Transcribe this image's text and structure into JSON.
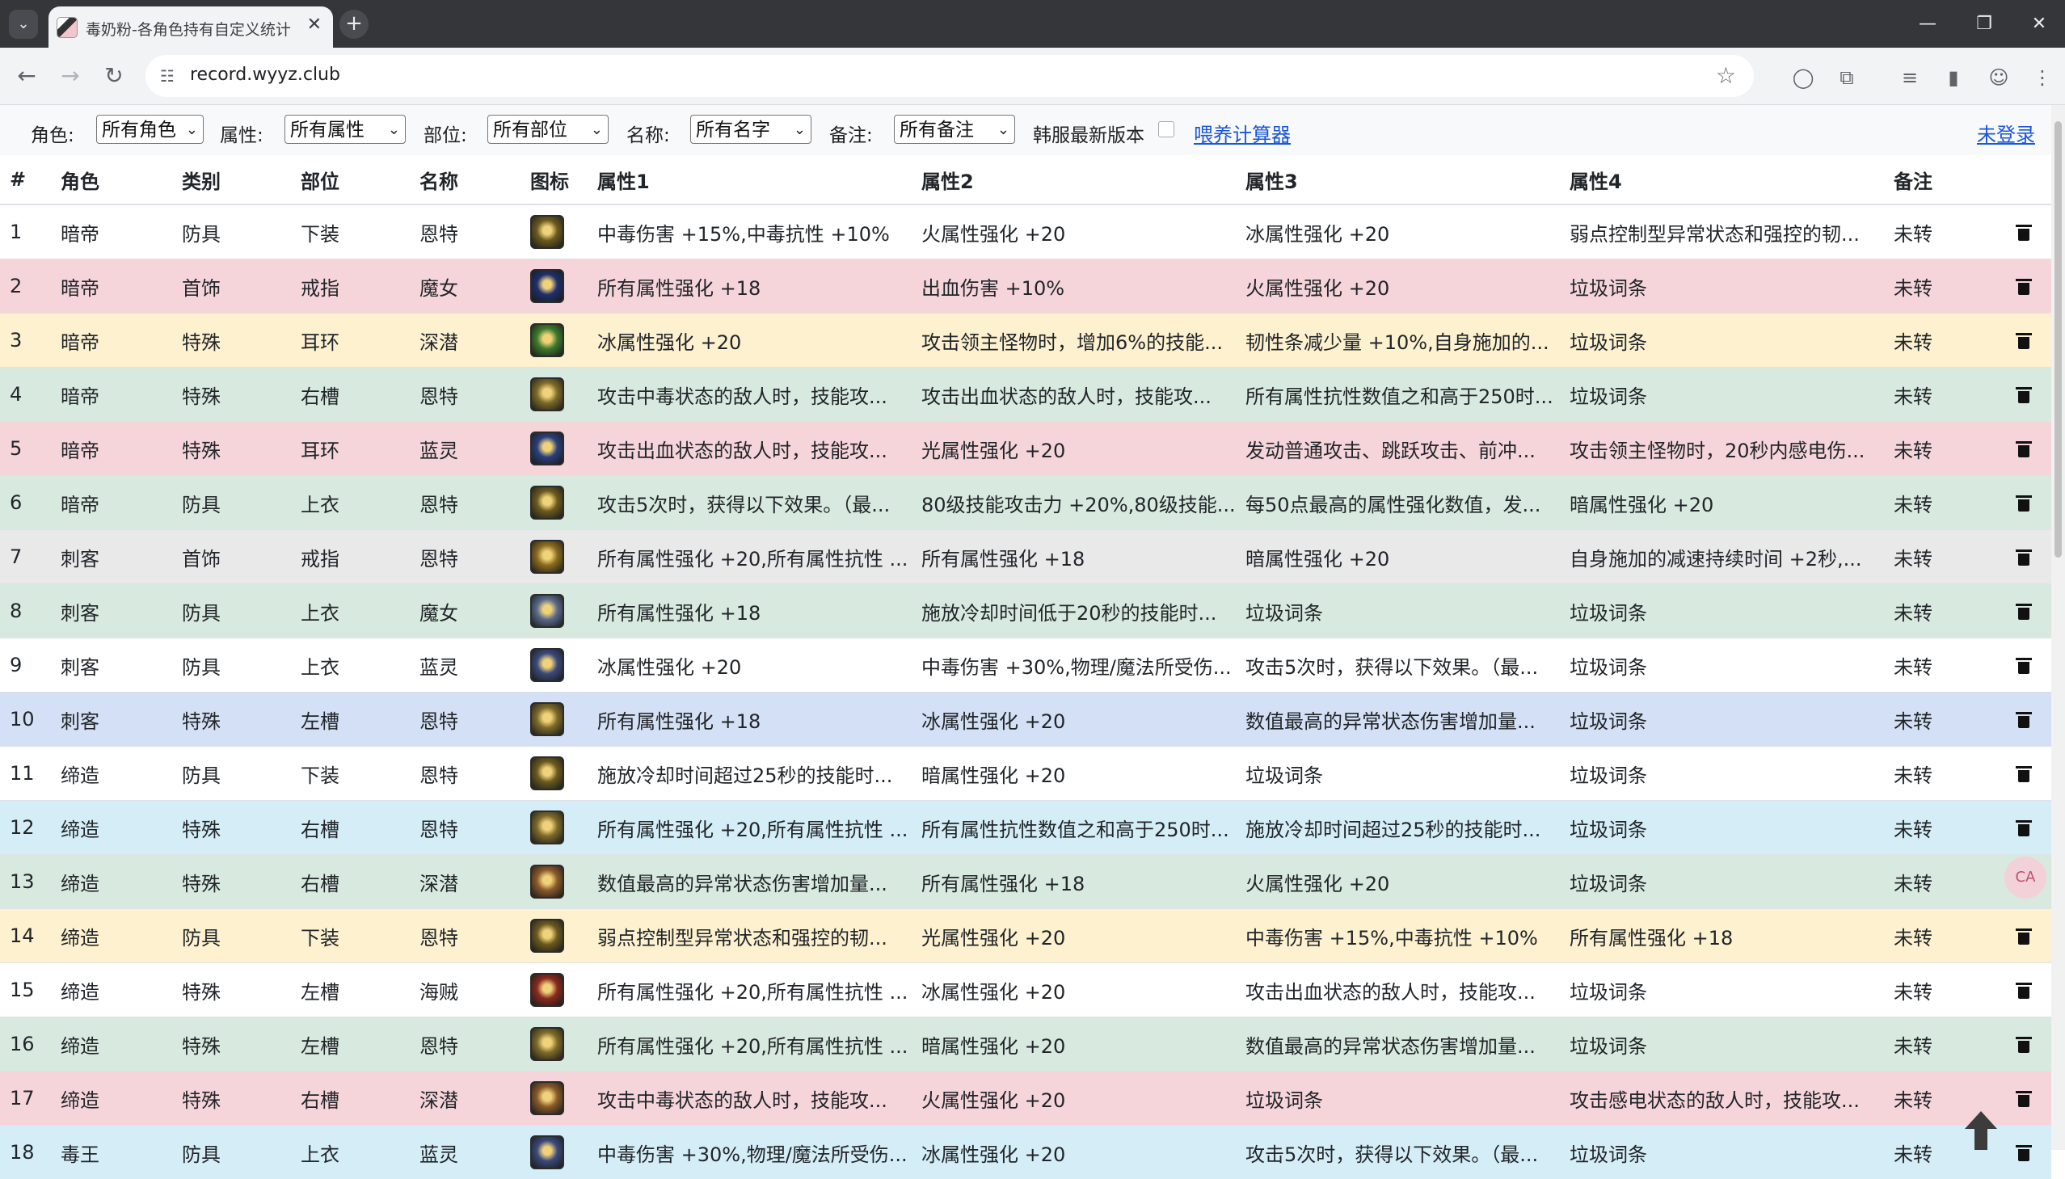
{
  "browser": {
    "tab_title": "毒奶粉-各角色持有自定义统计",
    "url": "record.wyyz.club"
  },
  "filters": {
    "role_label": "角色:",
    "role_value": "所有角色",
    "attr_label": "属性:",
    "attr_value": "所有属性",
    "part_label": "部位:",
    "part_value": "所有部位",
    "name_label": "名称:",
    "name_value": "所有名字",
    "note_label": "备注:",
    "note_value": "所有备注",
    "kr_label": "韩服最新版本",
    "calc_link": "喂养计算器",
    "login_link": "未登录"
  },
  "table": {
    "headers": [
      "#",
      "角色",
      "类别",
      "部位",
      "名称",
      "图标",
      "属性1",
      "属性2",
      "属性3",
      "属性4",
      "备注"
    ],
    "rows": [
      {
        "no": "1",
        "role": "暗帝",
        "cat": "防具",
        "part": "下装",
        "name": "恩特",
        "a1": "中毒伤害 +15%,中毒抗性 +10%",
        "a2": "火属性强化 +20",
        "a3": "冰属性强化 +20",
        "a4": "弱点控制型异常状态和强控的韧...",
        "note": "未转",
        "bg": "#ffffff",
        "icon": "#6b5a1f"
      },
      {
        "no": "2",
        "role": "暗帝",
        "cat": "首饰",
        "part": "戒指",
        "name": "魔女",
        "a1": "所有属性强化 +18",
        "a2": "出血伤害 +10%",
        "a3": "火属性强化 +20",
        "a4": "垃圾词条",
        "note": "未转",
        "bg": "#f5d5da",
        "icon": "#1e2f6b"
      },
      {
        "no": "3",
        "role": "暗帝",
        "cat": "特殊",
        "part": "耳环",
        "name": "深潜",
        "a1": "冰属性强化 +20",
        "a2": "攻击领主怪物时，增加6%的技能...",
        "a3": "韧性条减少量 +10%,自身施加的...",
        "a4": "垃圾词条",
        "note": "未转",
        "bg": "#fdf1cf",
        "icon": "#3e7a2c"
      },
      {
        "no": "4",
        "role": "暗帝",
        "cat": "特殊",
        "part": "右槽",
        "name": "恩特",
        "a1": "攻击中毒状态的敌人时，技能攻...",
        "a2": "攻击出血状态的敌人时，技能攻...",
        "a3": "所有属性抗性数值之和高于250时...",
        "a4": "垃圾词条",
        "note": "未转",
        "bg": "#d8e9df",
        "icon": "#7d6a2a"
      },
      {
        "no": "5",
        "role": "暗帝",
        "cat": "特殊",
        "part": "耳环",
        "name": "蓝灵",
        "a1": "攻击出血状态的敌人时，技能攻...",
        "a2": "光属性强化 +20",
        "a3": "发动普通攻击、跳跃攻击、前冲...",
        "a4": "攻击领主怪物时，20秒内感电伤...",
        "note": "未转",
        "bg": "#f5d5da",
        "icon": "#2a3f7a"
      },
      {
        "no": "6",
        "role": "暗帝",
        "cat": "防具",
        "part": "上衣",
        "name": "恩特",
        "a1": "攻击5次时，获得以下效果。（最...",
        "a2": "80级技能攻击力 +20%,80级技能...",
        "a3": "每50点最高的属性强化数值，发...",
        "a4": "暗属性强化 +20",
        "note": "未转",
        "bg": "#d8e9df",
        "icon": "#6b5a1f"
      },
      {
        "no": "7",
        "role": "刺客",
        "cat": "首饰",
        "part": "戒指",
        "name": "恩特",
        "a1": "所有属性强化 +20,所有属性抗性 ...",
        "a2": "所有属性强化 +18",
        "a3": "暗属性强化 +20",
        "a4": "自身施加的减速持续时间 +2秒,...",
        "note": "未转",
        "bg": "#e9e9ea",
        "icon": "#8a6b1f"
      },
      {
        "no": "8",
        "role": "刺客",
        "cat": "防具",
        "part": "上衣",
        "name": "魔女",
        "a1": "所有属性强化 +18",
        "a2": "施放冷却时间低于20秒的技能时...",
        "a3": "垃圾词条",
        "a4": "垃圾词条",
        "note": "未转",
        "bg": "#d8e9df",
        "icon": "#5a6a8a"
      },
      {
        "no": "9",
        "role": "刺客",
        "cat": "防具",
        "part": "上衣",
        "name": "蓝灵",
        "a1": "冰属性强化 +20",
        "a2": "中毒伤害 +30%,物理/魔法所受伤...",
        "a3": "攻击5次时，获得以下效果。（最...",
        "a4": "垃圾词条",
        "note": "未转",
        "bg": "#ffffff",
        "icon": "#3a4a7a"
      },
      {
        "no": "10",
        "role": "刺客",
        "cat": "特殊",
        "part": "左槽",
        "name": "恩特",
        "a1": "所有属性强化 +18",
        "a2": "冰属性强化 +20",
        "a3": "数值最高的异常状态伤害增加量...",
        "a4": "垃圾词条",
        "note": "未转",
        "bg": "#d4e0f5",
        "icon": "#7d6a2a"
      },
      {
        "no": "11",
        "role": "缔造",
        "cat": "防具",
        "part": "下装",
        "name": "恩特",
        "a1": "施放冷却时间超过25秒的技能时...",
        "a2": "暗属性强化 +20",
        "a3": "垃圾词条",
        "a4": "垃圾词条",
        "note": "未转",
        "bg": "#ffffff",
        "icon": "#6b5a1f"
      },
      {
        "no": "12",
        "role": "缔造",
        "cat": "特殊",
        "part": "右槽",
        "name": "恩特",
        "a1": "所有属性强化 +20,所有属性抗性 ...",
        "a2": "所有属性抗性数值之和高于250时...",
        "a3": "施放冷却时间超过25秒的技能时...",
        "a4": "垃圾词条",
        "note": "未转",
        "bg": "#d4edf7",
        "icon": "#7d6a2a"
      },
      {
        "no": "13",
        "role": "缔造",
        "cat": "特殊",
        "part": "右槽",
        "name": "深潜",
        "a1": "数值最高的异常状态伤害增加量...",
        "a2": "所有属性强化 +18",
        "a3": "火属性强化 +20",
        "a4": "垃圾词条",
        "note": "未转",
        "bg": "#d8e9df",
        "icon": "#8a5a2a"
      },
      {
        "no": "14",
        "role": "缔造",
        "cat": "防具",
        "part": "下装",
        "name": "恩特",
        "a1": "弱点控制型异常状态和强控的韧...",
        "a2": "光属性强化 +20",
        "a3": "中毒伤害 +15%,中毒抗性 +10%",
        "a4": "所有属性强化 +18",
        "note": "未转",
        "bg": "#fdf1cf",
        "icon": "#6b5a1f"
      },
      {
        "no": "15",
        "role": "缔造",
        "cat": "特殊",
        "part": "左槽",
        "name": "海贼",
        "a1": "所有属性强化 +20,所有属性抗性 ...",
        "a2": "冰属性强化 +20",
        "a3": "攻击出血状态的敌人时，技能攻...",
        "a4": "垃圾词条",
        "note": "未转",
        "bg": "#ffffff",
        "icon": "#8a2a1f"
      },
      {
        "no": "16",
        "role": "缔造",
        "cat": "特殊",
        "part": "左槽",
        "name": "恩特",
        "a1": "所有属性强化 +20,所有属性抗性 ...",
        "a2": "暗属性强化 +20",
        "a3": "数值最高的异常状态伤害增加量...",
        "a4": "垃圾词条",
        "note": "未转",
        "bg": "#d8e9df",
        "icon": "#7d6a2a"
      },
      {
        "no": "17",
        "role": "缔造",
        "cat": "特殊",
        "part": "右槽",
        "name": "深潜",
        "a1": "攻击中毒状态的敌人时，技能攻...",
        "a2": "火属性强化 +20",
        "a3": "垃圾词条",
        "a4": "攻击感电状态的敌人时，技能攻...",
        "note": "未转",
        "bg": "#f5d5da",
        "icon": "#8a5a2a"
      },
      {
        "no": "18",
        "role": "毒王",
        "cat": "防具",
        "part": "上衣",
        "name": "蓝灵",
        "a1": "中毒伤害 +30%,物理/魔法所受伤...",
        "a2": "冰属性强化 +20",
        "a3": "攻击5次时，获得以下效果。（最...",
        "a4": "垃圾词条",
        "note": "未转",
        "bg": "#d4edf7",
        "icon": "#3a4a7a"
      }
    ]
  }
}
